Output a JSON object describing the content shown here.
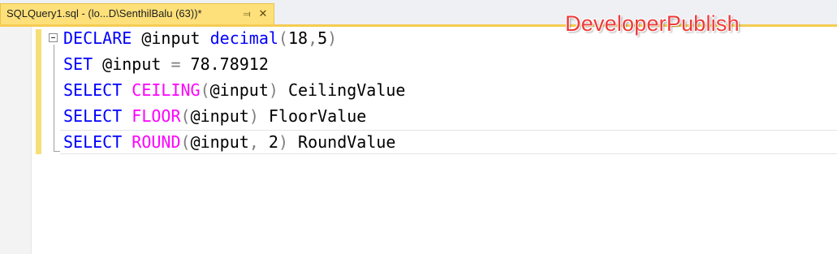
{
  "tab": {
    "title": "SQLQuery1.sql - (lo...D\\SenthilBalu (63))*",
    "pin_icon": "pin-icon",
    "close_icon": "close-icon",
    "pin_glyph": "⫤",
    "close_glyph": "✕"
  },
  "editor": {
    "collapse_icon": "collapse-minus-icon",
    "lines": [
      {
        "tokens": [
          {
            "text": "DECLARE",
            "kind": "keyword"
          },
          {
            "text": " @input ",
            "kind": "text"
          },
          {
            "text": "decimal",
            "kind": "keyword"
          },
          {
            "text": "(",
            "kind": "punct"
          },
          {
            "text": "18",
            "kind": "text"
          },
          {
            "text": ",",
            "kind": "punct"
          },
          {
            "text": "5",
            "kind": "text"
          },
          {
            "text": ")",
            "kind": "punct"
          }
        ]
      },
      {
        "tokens": [
          {
            "text": "SET",
            "kind": "keyword"
          },
          {
            "text": " @input ",
            "kind": "text"
          },
          {
            "text": "=",
            "kind": "punct"
          },
          {
            "text": " 78.78912",
            "kind": "text"
          }
        ]
      },
      {
        "tokens": [
          {
            "text": "SELECT",
            "kind": "keyword"
          },
          {
            "text": " ",
            "kind": "text"
          },
          {
            "text": "CEILING",
            "kind": "function"
          },
          {
            "text": "(",
            "kind": "punct"
          },
          {
            "text": "@input",
            "kind": "text"
          },
          {
            "text": ")",
            "kind": "punct"
          },
          {
            "text": " CeilingValue",
            "kind": "text"
          }
        ]
      },
      {
        "tokens": [
          {
            "text": "SELECT",
            "kind": "keyword"
          },
          {
            "text": " ",
            "kind": "text"
          },
          {
            "text": "FLOOR",
            "kind": "function"
          },
          {
            "text": "(",
            "kind": "punct"
          },
          {
            "text": "@input",
            "kind": "text"
          },
          {
            "text": ")",
            "kind": "punct"
          },
          {
            "text": " FloorValue",
            "kind": "text"
          }
        ]
      },
      {
        "tokens": [
          {
            "text": "SELECT",
            "kind": "keyword"
          },
          {
            "text": " ",
            "kind": "text"
          },
          {
            "text": "ROUND",
            "kind": "function"
          },
          {
            "text": "(",
            "kind": "punct"
          },
          {
            "text": "@input",
            "kind": "text"
          },
          {
            "text": ",",
            "kind": "punct"
          },
          {
            "text": " 2",
            "kind": "text"
          },
          {
            "text": ")",
            "kind": "punct"
          },
          {
            "text": " RoundValue",
            "kind": "text"
          }
        ]
      }
    ]
  },
  "watermark": {
    "text": "DeveloperPublish"
  },
  "colors": {
    "keyword": "#0000ff",
    "function": "#ff00ff",
    "punct": "#808080",
    "text": "#000000",
    "tab_active": "#fde07a",
    "tab_underline": "#f5cc54",
    "watermark": "#ee3a3a"
  }
}
